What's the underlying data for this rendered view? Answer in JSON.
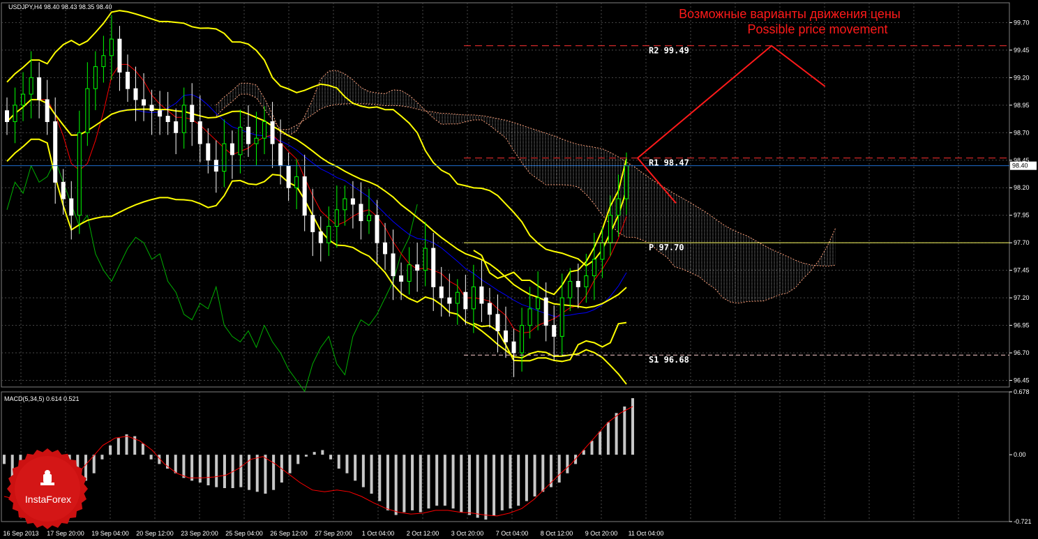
{
  "header": {
    "price_label": "USDJPY,H4  98.40 98.43 98.35 98.40",
    "macd_label": "MACD(5,34,5) 0.614 0.521"
  },
  "annotation": {
    "line1": "Возможные варианты движения цены",
    "line2": "Possible price movement"
  },
  "logo": {
    "text": "InstaForex"
  },
  "colors": {
    "background": "#000000",
    "grid": "#4a4a4a",
    "candle_bull": "#00ff00",
    "candle_bear": "#ffffff",
    "bollinger": "#ffff00",
    "tenkan": "#ff0000",
    "kijun": "#0000ff",
    "chikou": "#00b000",
    "kumo": "#ffa07a",
    "levels": "#ff3333",
    "forecast": "#ff1a1a",
    "current_price": "#1f6fcf",
    "pivot": "#ffff66",
    "macd_hist": "#c8c8c8",
    "macd_signal": "#ff0000"
  },
  "chart_data": [
    {
      "type": "candlestick",
      "symbol": "USDJPY",
      "timeframe": "H4",
      "last_quote": {
        "open": 98.4,
        "high": 98.43,
        "low": 98.35,
        "close": 98.4
      },
      "x_ticks": [
        "16 Sep 2013",
        "17 Sep 20:00",
        "19 Sep 04:00",
        "20 Sep 12:00",
        "23 Sep 20:00",
        "25 Sep 04:00",
        "26 Sep 12:00",
        "27 Sep 20:00",
        "1 Oct 04:00",
        "2 Oct 12:00",
        "3 Oct 20:00",
        "7 Oct 04:00",
        "8 Oct 12:00",
        "9 Oct 20:00",
        "11 Oct 04:00"
      ],
      "y_ticks": [
        "99.70",
        "99.45",
        "99.20",
        "98.95",
        "98.70",
        "98.45",
        "98.20",
        "97.95",
        "97.70",
        "97.45",
        "97.20",
        "96.95",
        "96.70",
        "96.45"
      ],
      "ylim": [
        96.39,
        99.88
      ],
      "current_price": {
        "value": 98.4,
        "label": "98.40"
      },
      "levels": [
        {
          "name": "R2",
          "value": 99.49,
          "label": "R2 99.49"
        },
        {
          "name": "R1",
          "value": 98.47,
          "label": "R1 98.47"
        },
        {
          "name": "P",
          "value": 97.7,
          "label": "P 97.70"
        },
        {
          "name": "S1",
          "value": 96.68,
          "label": "S1 96.68"
        }
      ],
      "forecast_paths": [
        {
          "name": "bullish",
          "points": [
            [
              0,
              98.47
            ],
            [
              1,
              99.49
            ],
            [
              1.4,
              99.12
            ]
          ]
        },
        {
          "name": "bearish",
          "points": [
            [
              0,
              98.47
            ],
            [
              1,
              98.06
            ]
          ]
        }
      ],
      "closes": [
        98.8,
        98.95,
        99.05,
        99.2,
        99.0,
        98.8,
        98.25,
        98.1,
        97.95,
        98.7,
        99.1,
        99.3,
        99.4,
        99.55,
        99.25,
        99.1,
        99.0,
        98.95,
        98.9,
        98.85,
        98.8,
        98.7,
        98.95,
        98.8,
        98.6,
        98.45,
        98.35,
        98.6,
        98.5,
        98.75,
        98.6,
        98.65,
        98.8,
        98.6,
        98.4,
        98.2,
        98.3,
        97.95,
        97.8,
        97.7,
        97.85,
        98.0,
        98.1,
        98.05,
        97.9,
        97.95,
        97.7,
        97.6,
        97.4,
        97.35,
        97.5,
        97.45,
        97.65,
        97.3,
        97.2,
        97.15,
        97.25,
        97.1,
        97.3,
        97.15,
        97.05,
        96.9,
        96.8,
        96.7,
        96.95,
        97.1,
        97.2,
        96.95,
        96.85,
        97.2,
        97.35,
        97.3,
        97.4,
        97.55,
        97.7,
        97.95,
        98.1,
        98.4
      ],
      "macd": {
        "ylim": [
          -0.721,
          0.678
        ],
        "y_ticks": [
          "0.678",
          "0.00",
          "-0.721"
        ],
        "histogram": [
          -0.1,
          -0.25,
          -0.42,
          -0.6,
          -0.68,
          -0.55,
          -0.4,
          -0.38,
          -0.35,
          -0.3,
          -0.28,
          -0.2,
          -0.05,
          0.1,
          0.18,
          0.22,
          0.2,
          0.12,
          -0.05,
          -0.1,
          -0.15,
          -0.2,
          -0.25,
          -0.28,
          -0.3,
          -0.33,
          -0.35,
          -0.36,
          -0.36,
          -0.35,
          -0.38,
          -0.4,
          -0.42,
          -0.38,
          -0.3,
          -0.2,
          -0.1,
          -0.02,
          0.03,
          0.05,
          -0.05,
          -0.15,
          -0.2,
          -0.28,
          -0.35,
          -0.42,
          -0.5,
          -0.6,
          -0.65,
          -0.62,
          -0.6,
          -0.62,
          -0.58,
          -0.55,
          -0.55,
          -0.58,
          -0.62,
          -0.65,
          -0.68,
          -0.7,
          -0.66,
          -0.6,
          -0.58,
          -0.55,
          -0.5,
          -0.45,
          -0.4,
          -0.35,
          -0.3,
          -0.2,
          -0.1,
          0.05,
          0.15,
          0.25,
          0.35,
          0.45,
          0.52,
          0.61
        ],
        "signal": [
          -0.45,
          -0.48,
          -0.5,
          -0.5,
          -0.45,
          -0.35,
          -0.2,
          -0.05,
          0.1,
          0.18,
          0.2,
          0.15,
          0.05,
          -0.1,
          -0.2,
          -0.25,
          -0.25,
          -0.24,
          -0.22,
          -0.15,
          -0.05,
          -0.02,
          -0.1,
          -0.2,
          -0.3,
          -0.38,
          -0.4,
          -0.38,
          -0.4,
          -0.45,
          -0.52,
          -0.58,
          -0.62,
          -0.64,
          -0.63,
          -0.6,
          -0.6,
          -0.62,
          -0.63,
          -0.65,
          -0.66,
          -0.63,
          -0.58,
          -0.48,
          -0.35,
          -0.22,
          -0.1,
          0.05,
          0.2,
          0.35,
          0.45,
          0.52
        ]
      }
    }
  ]
}
